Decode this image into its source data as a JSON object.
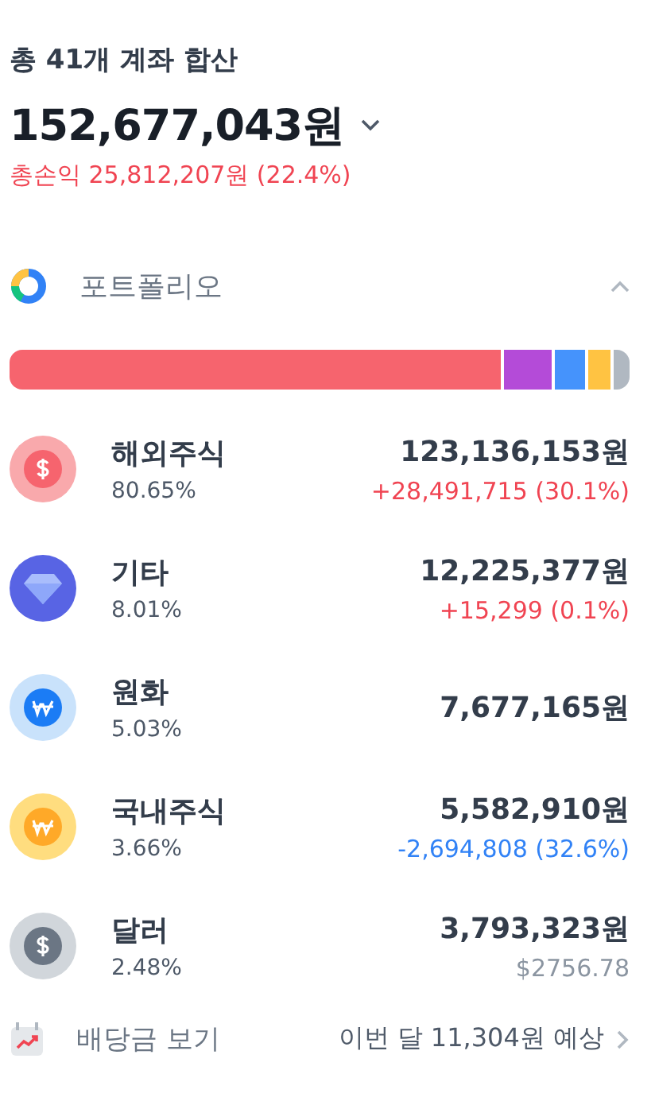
{
  "summary": {
    "title": "총 41개 계좌 합산",
    "total": "152,677,043원",
    "profit": "총손익 25,812,207원 (22.4%)"
  },
  "portfolio": {
    "title": "포트폴리오",
    "expanded": true
  },
  "assets": [
    {
      "name": "해외주식",
      "share": "80.65%",
      "amount": "123,136,153원",
      "change": "+28,491,715 (30.1%)",
      "kind": "foreign",
      "color": "#f6646e"
    },
    {
      "name": "기타",
      "share": "8.01%",
      "amount": "12,225,377원",
      "change": "+15,299 (0.1%)",
      "kind": "other",
      "color": "#b44bd8"
    },
    {
      "name": "원화",
      "share": "5.03%",
      "amount": "7,677,165원",
      "kind": "cash",
      "color": "#4593fc"
    },
    {
      "name": "국내주식",
      "share": "3.66%",
      "amount": "5,582,910원",
      "change": "-2,694,808 (32.6%)",
      "kind": "domestic",
      "color": "#ffc342"
    },
    {
      "name": "달러",
      "share": "2.48%",
      "amount": "3,793,323원",
      "change": "$2756.78",
      "kind": "usd",
      "color": "#b0b8c1"
    }
  ],
  "dividend": {
    "label": "배당금 보기",
    "value": "이번 달 11,304원 예상"
  }
}
